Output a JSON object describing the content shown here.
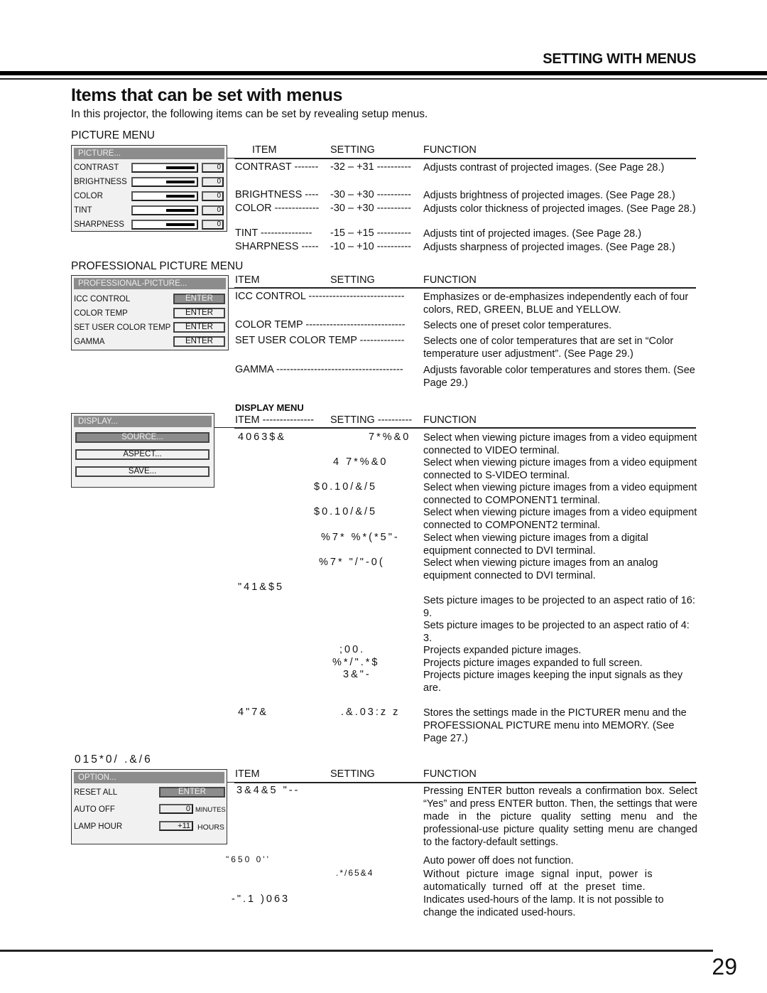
{
  "header": {
    "section_title": "SETTING WITH MENUS",
    "page_title": "Items that can be set with menus",
    "intro": "In this projector, the following items can be set by revealing setup menus."
  },
  "picture_menu": {
    "heading": "PICTURE MENU",
    "osd": {
      "title": "PICTURE...",
      "rows": [
        {
          "label": "CONTRAST",
          "level": 0.5,
          "value": "0"
        },
        {
          "label": "BRIGHTNESS",
          "level": 0.5,
          "value": "0"
        },
        {
          "label": "COLOR",
          "level": 0.5,
          "value": "0"
        },
        {
          "label": "TINT",
          "level": 0.5,
          "value": "0"
        },
        {
          "label": "SHARPNESS",
          "level": 0.5,
          "value": "0"
        }
      ]
    },
    "columns": {
      "item": "ITEM",
      "setting": "SETTING",
      "function": "FUNCTION"
    },
    "rows": [
      {
        "item": "CONTRAST -------",
        "setting": "-32 – +31 ----------",
        "function": "Adjusts contrast of projected images. (See Page 28.)"
      },
      {
        "item": "BRIGHTNESS ----",
        "setting": "-30 – +30 ----------",
        "function": "Adjusts brightness of projected images. (See Page 28.)"
      },
      {
        "item": "COLOR -------------",
        "setting": "-30 – +30 ----------",
        "function": "Adjusts color thickness of projected images. (See Page 28.)"
      },
      {
        "item": "TINT   ---------------",
        "setting": "-15 – +15 ----------",
        "function": "Adjusts tint of projected images. (See Page 28.)"
      },
      {
        "item": "SHARPNESS -----",
        "setting": "-10 – +10 ----------",
        "function": "Adjusts sharpness of projected images. (See Page 28.)"
      }
    ]
  },
  "professional_menu": {
    "heading": "PROFESSIONAL PICTURE MENU",
    "osd": {
      "title": "PROFESSIONAL-PICTURE...",
      "rows": [
        {
          "label": "ICC CONTROL",
          "button": "ENTER",
          "active": true
        },
        {
          "label": "COLOR TEMP",
          "button": "ENTER",
          "active": false
        },
        {
          "label": "SET USER COLOR TEMP",
          "button": "ENTER",
          "active": false
        },
        {
          "label": "GAMMA",
          "button": "ENTER",
          "active": false
        }
      ]
    },
    "columns": {
      "item": "ITEM",
      "setting": "SETTING",
      "function": "FUNCTION"
    },
    "rows": [
      {
        "item": "ICC CONTROL ----------------------------",
        "function": "Emphasizes or de-emphasizes independently each of four colors, RED, GREEN, BLUE and YELLOW."
      },
      {
        "item": "COLOR TEMP -----------------------------",
        "function": "Selects one of preset color temperatures."
      },
      {
        "item": "SET USER COLOR TEMP -------------",
        "function": "Selects one of color temperatures that are set in “Color temperature user adjustment”. (See Page 29.)"
      },
      {
        "item": "GAMMA -------------------------------------",
        "function": "Adjusts favorable color temperatures and stores them. (See Page 29.)"
      }
    ]
  },
  "display_menu": {
    "heading": "DISPLAY MENU",
    "osd": {
      "title": "DISPLAY...",
      "buttons": [
        {
          "label": "SOURCE...",
          "active": true
        },
        {
          "label": "ASPECT...",
          "active": false
        },
        {
          "label": "SAVE...",
          "active": false
        }
      ]
    },
    "columns": {
      "item": "ITEM  ---------------",
      "setting": "SETTING ----------",
      "function": "FUNCTION"
    },
    "groups": [
      {
        "item": "4063$&",
        "rows": [
          {
            "setting": "7*%&0",
            "function": "Select when viewing picture images from a video equipment connected to VIDEO terminal."
          },
          {
            "setting": "4 7*%&0",
            "function": "Select when viewing picture images from a video equipment connected to S-VIDEO terminal."
          },
          {
            "setting": "$0.10/&/5",
            "function": "Select when viewing picture images from a video equipment connected to COMPONENT1 terminal."
          },
          {
            "setting": "$0.10/&/5",
            "function": "Select when viewing picture images from a video equipment connected to COMPONENT2 terminal."
          },
          {
            "setting": "%7*  %*(*5\"-",
            "function": "Select when viewing picture images from a digital equipment connected to DVI terminal."
          },
          {
            "setting": "%7*  \"/\"-0(",
            "function": "Select when viewing picture images from an analog equipment connected to DVI terminal."
          }
        ]
      },
      {
        "item": "\"41&$5",
        "rows": [
          {
            "setting": "",
            "function": "Sets picture images to be projected to an aspect ratio of 16: 9."
          },
          {
            "setting": "",
            "function": "Sets picture images to be projected to an aspect ratio of 4: 3."
          },
          {
            "setting": ";00.",
            "function": "Projects expanded picture images."
          },
          {
            "setting": "%*/\".*$",
            "function": "Projects picture images expanded to full screen."
          },
          {
            "setting": "3&\"-",
            "function": "Projects picture images keeping the input signals as they are."
          }
        ]
      },
      {
        "item": "4\"7&",
        "rows": [
          {
            "setting": ".&.03:z z",
            "function": "Stores the settings made in the PICTURER menu and the PROFESSIONAL PICTURE menu into MEMORY. (See Page 27.)"
          }
        ]
      }
    ]
  },
  "option_menu": {
    "heading": "015*0/  .&/6",
    "osd": {
      "title": "OPTION...",
      "rows": [
        {
          "label": "RESET ALL",
          "button": "ENTER"
        },
        {
          "label": "AUTO OFF",
          "value": "0",
          "unit": "MINUTES"
        },
        {
          "label": "LAMP HOUR",
          "value": "+11",
          "unit": "HOURS"
        }
      ]
    },
    "columns": {
      "item": "ITEM",
      "setting": "SETTING",
      "function": "FUNCTION"
    },
    "rows": [
      {
        "item": "3&4&5  \"--",
        "setting": "",
        "function": "Pressing ENTER button reveals a confirmation box. Select “Yes” and press ENTER button. Then, the settings that were made in the picture quality setting menu and the professional-use picture quality setting menu are changed to the factory-default settings."
      },
      {
        "item": "\"650 0''",
        "setting": "",
        "function": "Auto power off does not function."
      },
      {
        "item": "",
        "setting": ".*/65&4",
        "function": "Without picture image signal input, power is automatically turned off at the preset time."
      },
      {
        "item": "-\".1  )063",
        "setting": "",
        "function": "Indicates used-hours of the lamp. It is not possible to change the indicated used-hours."
      }
    ]
  },
  "footer": {
    "page_number": "29"
  }
}
